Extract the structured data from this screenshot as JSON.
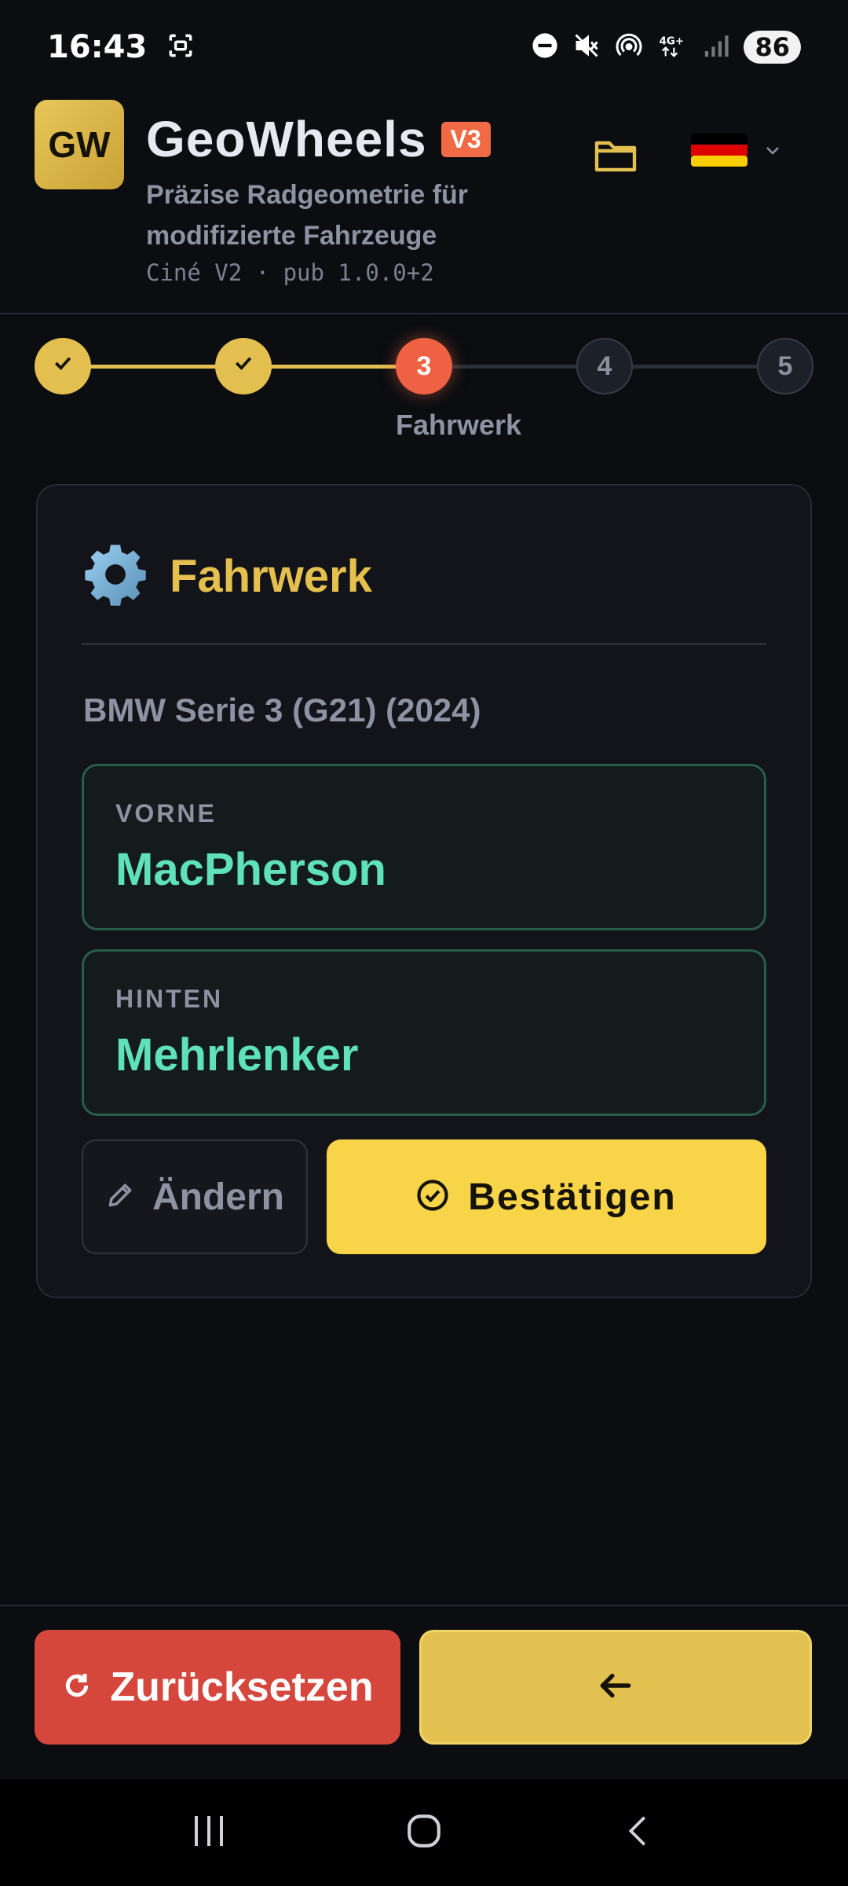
{
  "status_bar": {
    "time": "16:43",
    "battery": "86"
  },
  "header": {
    "logo": "GW",
    "title": "GeoWheels",
    "version_badge": "V3",
    "subtitle": "Präzise Radgeometrie für modifizierte Fahrzeuge",
    "build_info": "Ciné V2 · pub 1.0.0+2",
    "folder_icon": "folder-icon",
    "language_flag": "flag-de-icon"
  },
  "stepper": {
    "steps": [
      {
        "state": "done",
        "label": ""
      },
      {
        "state": "done",
        "label": ""
      },
      {
        "state": "current",
        "label": "3"
      },
      {
        "state": "todo",
        "label": "4"
      },
      {
        "state": "todo",
        "label": "5"
      }
    ],
    "current_label": "Fahrwerk"
  },
  "card": {
    "title": "Fahrwerk",
    "icon": "gear-icon",
    "vehicle": "BMW Serie 3 (G21) (2024)",
    "front": {
      "label": "VORNE",
      "value": "MacPherson"
    },
    "rear": {
      "label": "HINTEN",
      "value": "Mehrlenker"
    },
    "edit_label": "Ändern",
    "confirm_label": "Bestätigen"
  },
  "actions": {
    "reset_label": "Zurücksetzen",
    "back_icon": "arrow-left-icon"
  },
  "colors": {
    "accent": "#e3bf50",
    "current_step": "#ee6143",
    "confirm": "#f7d448",
    "reset": "#d5473c",
    "value_green": "#5fe2b8"
  }
}
